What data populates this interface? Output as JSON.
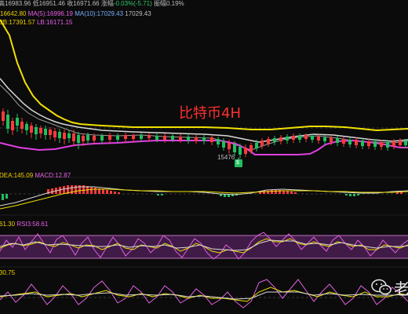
{
  "header": {
    "row1": {
      "high_label": "高",
      "high": "16983.96",
      "low_label": "低",
      "low": "16951.46",
      "close_label": "收",
      "close": "16971.66",
      "change_label": "涨幅",
      "change": "-0.03%(-5.71)",
      "amp_label": "振幅",
      "amp": "0.19%"
    },
    "row2": {
      "ma_a": "16642.80",
      "ma5_label": "MA(5):",
      "ma5": "16996.19",
      "ma10_label": "MA(10):",
      "ma10": "17029.43",
      "ma10_b": "17029.43"
    },
    "row3": {
      "ub_label": "UB:",
      "ub": "17391.57",
      "lb_label": "LB:",
      "lb": "16171.15"
    }
  },
  "chart_title": "比特币4H",
  "min_marker": "15476",
  "min_badge": "$",
  "macd": {
    "dea_label": "DEA:",
    "dea": "145.09",
    "macd_label": "MACD:",
    "macd": "12.87"
  },
  "rsi": {
    "rsi_a": "61.30",
    "rsi3_label": "RSI3:",
    "rsi3": "58.61"
  },
  "kdj": {
    "val": "30.75"
  },
  "watermark": {
    "icon": "wechat-icon",
    "text": "老"
  },
  "colors": {
    "background": "#0b0b0b",
    "upper_band": "#f0e000",
    "lower_band": "#e040e0",
    "mid_line": "#d8d8d8",
    "up_candle": "#ff3a3a",
    "down_candle": "#20c060",
    "title": "#ff3030"
  }
}
